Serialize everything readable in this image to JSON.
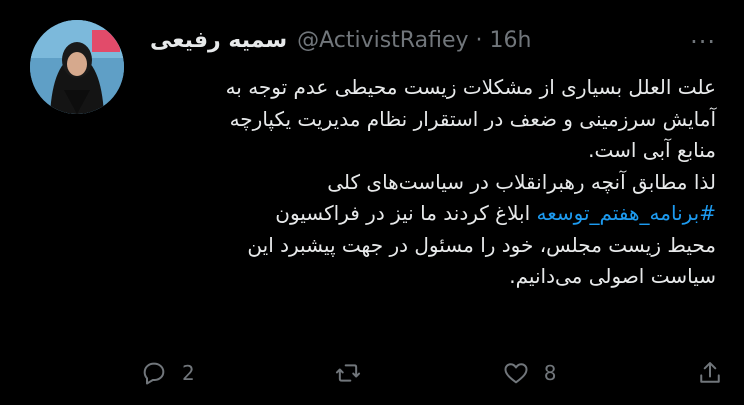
{
  "tweet": {
    "display_name": "سمیه رفیعی",
    "handle_line": "@ActivistRafiey · 16h",
    "more_icon": "more-horizontal-icon",
    "lines": [
      "علت العلل بسیاری از مشکلات زیست محیطی عدم توجه به",
      "آمایش سرزمینی و ضعف در استقرار نظام مدیریت یکپارچه",
      "منابع آبی است.",
      "لذا مطابق آنچه رهبرانقلاب در سیاست‌های کلی"
    ],
    "hashtag": "#برنامه_هفتم_توسعه",
    "line5_rest": " ابلاغ کردند ما نیز در فراکسیون",
    "lines_after": [
      "محیط زیست مجلس، خود را مسئول در جهت پیشبرد این",
      "سیاست اصولی می‌دانیم."
    ],
    "hashtag_color": "#1d9bf0"
  },
  "actions": {
    "reply_count": "2",
    "like_count": "8",
    "icons": [
      "reply-icon",
      "retweet-icon",
      "like-icon",
      "share-icon"
    ]
  }
}
